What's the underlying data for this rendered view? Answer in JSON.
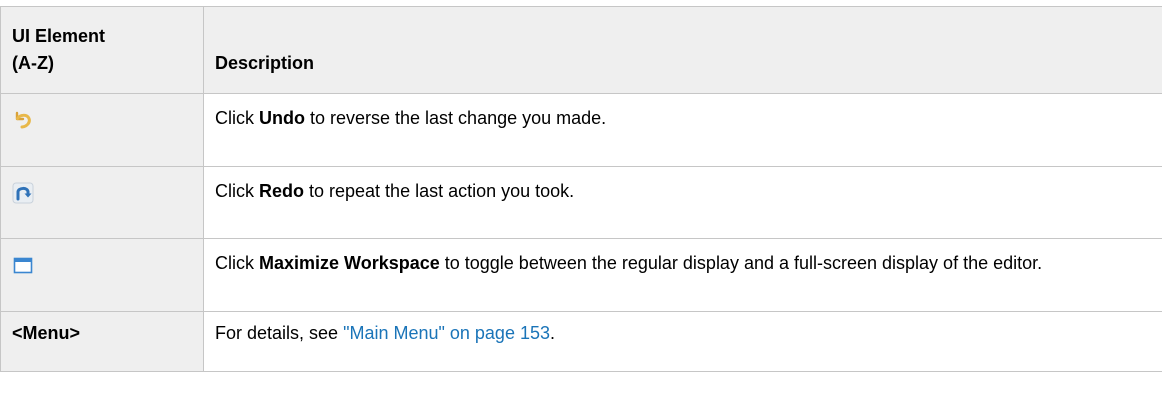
{
  "table": {
    "headers": {
      "element_line1": "UI Element",
      "element_line2": "(A-Z)",
      "description": "Description"
    },
    "rows": [
      {
        "element_icon": "undo-icon",
        "desc_prefix": "Click ",
        "desc_bold": "Undo",
        "desc_suffix": " to reverse the last change you made."
      },
      {
        "element_icon": "redo-icon",
        "desc_prefix": "Click ",
        "desc_bold": "Redo",
        "desc_suffix": " to repeat the last action you took."
      },
      {
        "element_icon": "maximize-workspace-icon",
        "desc_prefix": "Click ",
        "desc_bold": "Maximize Workspace",
        "desc_suffix": " to toggle between the regular display and a full-screen display of the editor."
      },
      {
        "element_label": "<Menu>",
        "desc_prefix": "For details, see ",
        "desc_link": "\"Main Menu\" on page 153",
        "desc_suffix": "."
      }
    ]
  },
  "colors": {
    "header_bg": "#efefef",
    "element_cell_bg": "#efefef",
    "border": "#c6c6c6",
    "link": "#1a74b8",
    "undo_icon": "#e8b84a",
    "redo_icon": "#3a7fc4",
    "maximize_icon": "#3a86d0"
  }
}
